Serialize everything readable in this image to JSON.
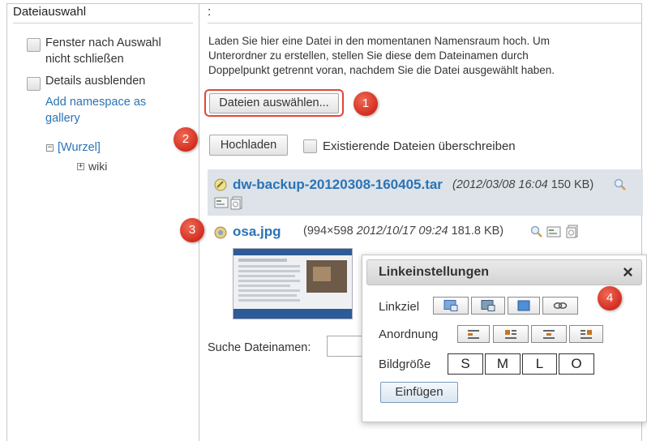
{
  "left_pane": {
    "title": "Dateiauswahl",
    "options": [
      {
        "label_line1": "Fenster nach Auswahl",
        "label_line2": "nicht schließen"
      },
      {
        "label_line1": "Details ausblenden",
        "label_line2": ""
      }
    ],
    "add_namespace_line1": "Add namespace as",
    "add_namespace_line2": "gallery",
    "tree": {
      "root_toggle": "−",
      "root_label": "[Wurzel]",
      "child_toggle": "+",
      "child_label": "wiki"
    }
  },
  "main": {
    "header": ":",
    "intro_line1": "Laden Sie hier eine Datei in den momentanen Namensraum hoch. Um",
    "intro_line2": "Unterordner zu erstellen, stellen Sie diese dem Dateinamen durch",
    "intro_line3": "Doppelpunkt getrennt voran, nachdem Sie die Datei ausgewählt haben.",
    "choose_files_button": "Dateien auswählen...",
    "upload_button": "Hochladen",
    "overwrite_label": "Existierende Dateien überschreiben",
    "files": [
      {
        "name": "dw-backup-20120308-160405.tar",
        "date": "(2012/03/08 16:04",
        "size": "150 KB)"
      },
      {
        "name": "osa.jpg",
        "dimensions": "(994×598",
        "date": "2012/10/17 09:24",
        "size": "181.8 KB)"
      }
    ],
    "search_label": "Suche Dateinamen:"
  },
  "callouts": [
    "1",
    "2",
    "3",
    "4"
  ],
  "popup": {
    "title": "Linkeinstellungen",
    "close": "×",
    "linkziel_label": "Linkziel",
    "anordnung_label": "Anordnung",
    "bildgroesse_label": "Bildgröße",
    "sizes": [
      "S",
      "M",
      "L",
      "O"
    ],
    "insert_button": "Einfügen"
  },
  "colors": {
    "link": "#2b73b7",
    "callout": "#d22d20",
    "highlight": "#e0463a",
    "file_row_bg": "#dde3e8"
  }
}
